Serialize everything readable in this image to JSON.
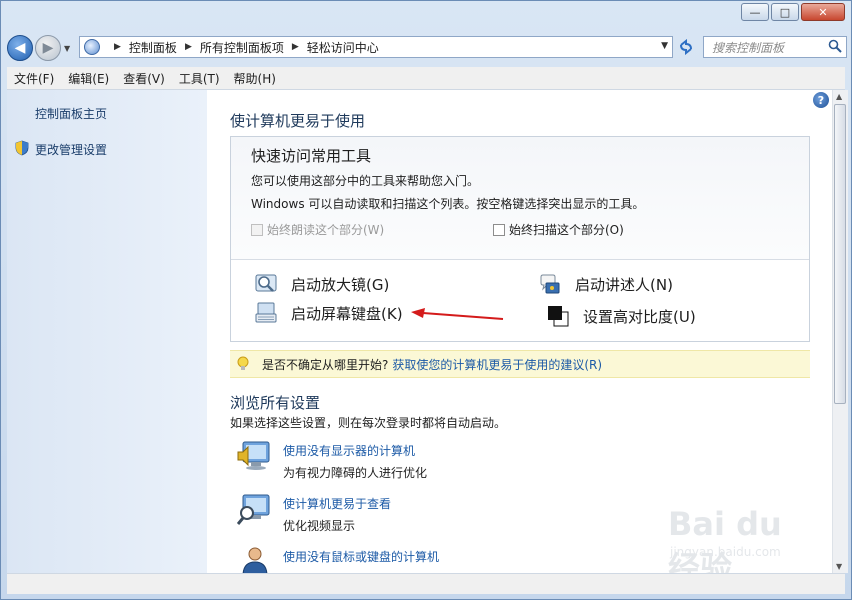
{
  "window": {
    "minimize_label": "—",
    "maximize_label": "□",
    "close_label": "✕"
  },
  "nav": {
    "breadcrumbs": [
      "控制面板",
      "所有控制面板项",
      "轻松访问中心"
    ],
    "search_placeholder": "搜索控制面板"
  },
  "menu": [
    "文件(F)",
    "编辑(E)",
    "查看(V)",
    "工具(T)",
    "帮助(H)"
  ],
  "sidebar": {
    "items": [
      {
        "label": "控制面板主页"
      },
      {
        "label": "更改管理设置",
        "icon": "uac-shield-icon"
      }
    ]
  },
  "main": {
    "title": "使计算机更易于使用",
    "quick": {
      "title": "快速访问常用工具",
      "desc1": "您可以使用这部分中的工具来帮助您入门。",
      "desc2": "Windows 可以自动读取和扫描这个列表。按空格键选择突出显示的工具。",
      "check_read": "始终朗读这个部分(W)",
      "check_read_checked": false,
      "check_read_disabled": true,
      "check_scan": "始终扫描这个部分(O)",
      "check_scan_checked": false,
      "tools": [
        {
          "label": "启动放大镜(G)",
          "icon": "magnifier-icon"
        },
        {
          "label": "启动讲述人(N)",
          "icon": "narrator-icon"
        },
        {
          "label": "启动屏幕键盘(K)",
          "icon": "keyboard-icon"
        },
        {
          "label": "设置高对比度(U)",
          "icon": "high-contrast-icon"
        }
      ]
    },
    "tip": {
      "text": "是否不确定从哪里开始?",
      "link": "获取使您的计算机更易于使用的建议(R)"
    },
    "browse": {
      "title": "浏览所有设置",
      "desc": "如果选择这些设置，则在每次登录时都将自动启动。",
      "items": [
        {
          "title": "使用没有显示器的计算机",
          "desc": "为有视力障碍的人进行优化",
          "icon": "monitor-speaker-icon"
        },
        {
          "title": "使计算机更易于查看",
          "desc": "优化视频显示",
          "icon": "monitor-magnifier-icon"
        },
        {
          "title": "使用没有鼠标或键盘的计算机",
          "desc": "",
          "icon": "person-icon"
        }
      ]
    }
  },
  "watermark": {
    "text": "Bai du 经验",
    "sub": "jingyan.baidu.com"
  },
  "colors": {
    "link": "#1c5aa6",
    "heading": "#1e395b",
    "tip_background": "#fbf8d6",
    "annotation_arrow": "#d41b1b"
  }
}
